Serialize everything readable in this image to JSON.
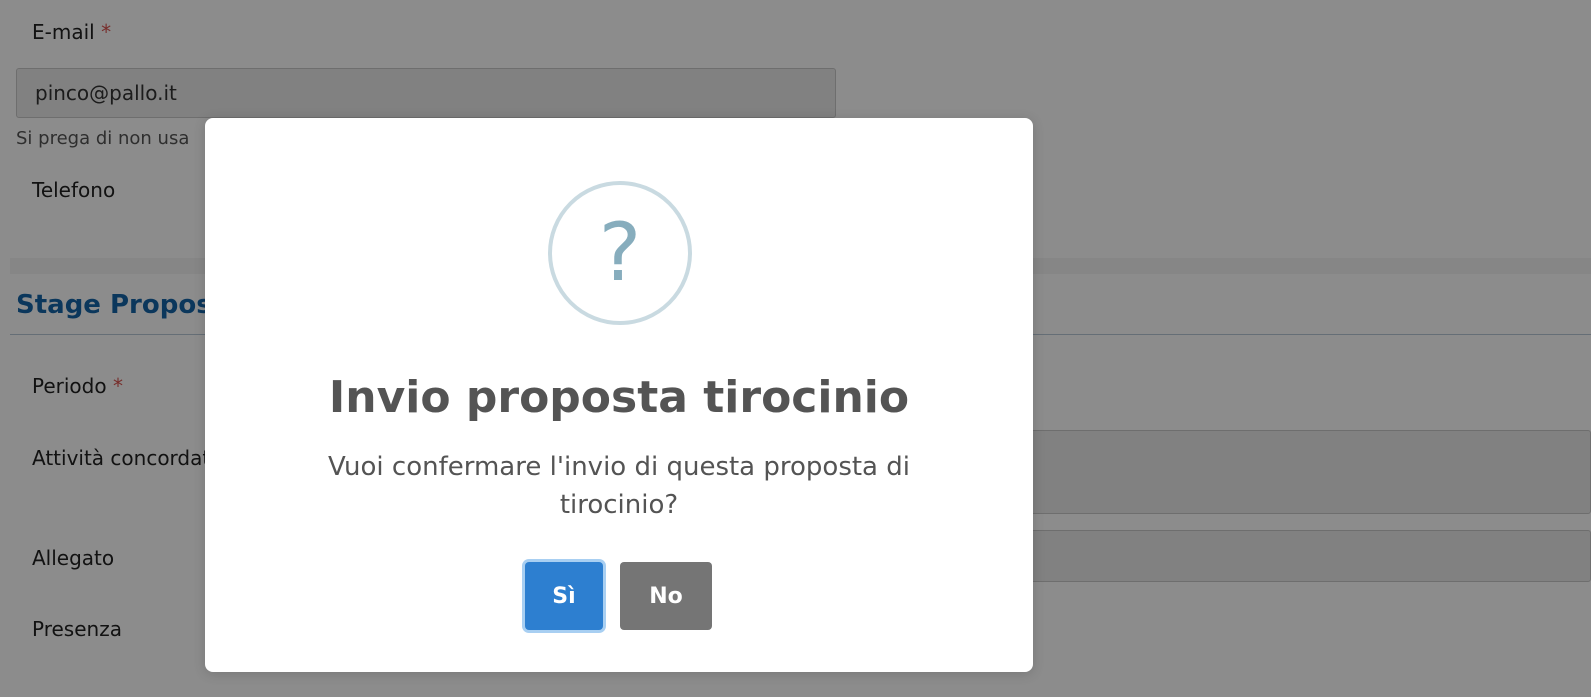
{
  "form": {
    "email_label": "E-mail",
    "required_mark": "*",
    "email_value": "pinco@pallo.it",
    "email_help": "Si prega di non usa",
    "phone_label": "Telefono",
    "section_title": "Stage Proposto",
    "period_label": "Periodo",
    "activities_label": "Attività concordate",
    "attachment_label": "Allegato",
    "presence_label": "Presenza"
  },
  "dialog": {
    "icon": "question-icon",
    "icon_glyph": "?",
    "title": "Invio proposta tirocinio",
    "text": "Vuoi confermare l'invio di questa proposta di tirocinio?",
    "confirm_label": "Sì",
    "cancel_label": "No",
    "confirm_color": "#2d7fd0",
    "cancel_color": "#757575"
  }
}
